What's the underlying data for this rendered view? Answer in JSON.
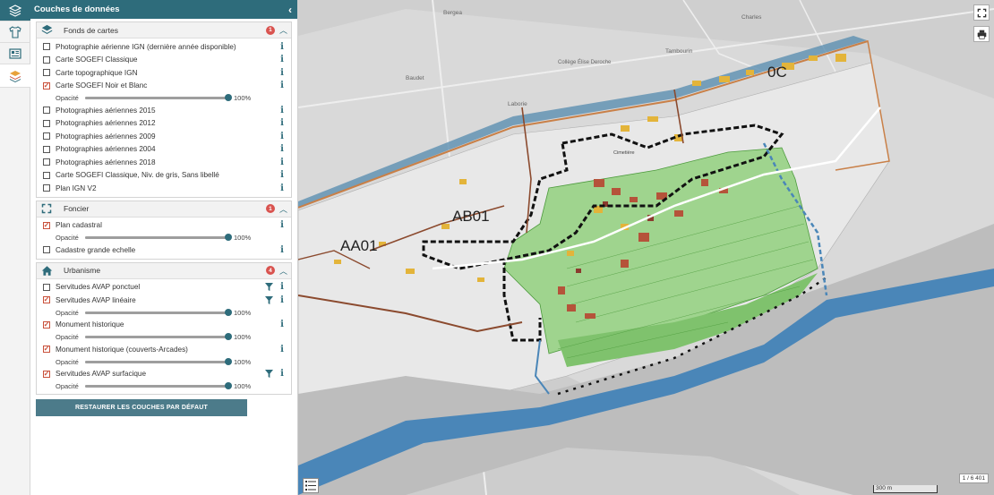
{
  "panel": {
    "title": "Couches de données"
  },
  "sections": {
    "fonds": {
      "title": "Fonds de cartes",
      "badge": "1",
      "layers": [
        {
          "label": "Photographie aérienne IGN (dernière année disponible)",
          "checked": false
        },
        {
          "label": "Carte SOGEFI Classique",
          "checked": false
        },
        {
          "label": "Carte topographique IGN",
          "checked": false
        },
        {
          "label": "Carte SOGEFI Noir et Blanc",
          "checked": true
        },
        {
          "label": "Photographies aériennes 2015",
          "checked": false
        },
        {
          "label": "Photographies aériennes 2012",
          "checked": false
        },
        {
          "label": "Photographies aériennes 2009",
          "checked": false
        },
        {
          "label": "Photographies aériennes 2004",
          "checked": false
        },
        {
          "label": "Photographies aériennes 2018",
          "checked": false
        },
        {
          "label": "Carte SOGEFI Classique, Niv. de gris, Sans libellé",
          "checked": false
        },
        {
          "label": "Plan IGN V2",
          "checked": false
        }
      ],
      "opacity": {
        "label": "Opacité",
        "value": "100%",
        "fraction": 1.0
      }
    },
    "foncier": {
      "title": "Foncier",
      "badge": "1",
      "layers": [
        {
          "label": "Plan cadastral",
          "checked": true
        },
        {
          "label": "Cadastre grande echelle",
          "checked": false
        }
      ],
      "opacity": {
        "label": "Opacité",
        "value": "100%",
        "fraction": 1.0
      }
    },
    "urbanisme": {
      "title": "Urbanisme",
      "badge": "4",
      "layers": [
        {
          "label": "Servitudes AVAP ponctuel",
          "checked": false
        },
        {
          "label": "Servitudes AVAP linéaire",
          "checked": true
        },
        {
          "label": "Monument historique",
          "checked": true
        },
        {
          "label": "Monument historique (couverts-Arcades)",
          "checked": true
        },
        {
          "label": "Servitudes AVAP surfacique",
          "checked": true
        }
      ],
      "opacity": {
        "label": "Opacité",
        "value": "100%",
        "fraction": 1.0
      }
    }
  },
  "restore_button": "RESTAURER LES COUCHES PAR DÉFAUT",
  "map": {
    "parcel_labels": [
      "0C",
      "AB01",
      "AA01"
    ],
    "place_labels": [
      "Bergea",
      "Charles",
      "Tambourin",
      "Baudet",
      "Laborie",
      "Collège Élise Deroche",
      "Cimetière"
    ],
    "scale_ratio": "1 / 6 401",
    "scale_bar": "300 m"
  },
  "colors": {
    "header": "#2e6c7b",
    "check": "#c9503a",
    "badge": "#d9534f",
    "river": "#4a86b8",
    "zone_green": "#8fcf7f",
    "building_orange": "#e3b43a"
  },
  "icons": {
    "rail": [
      "layers-icon",
      "shirt-icon",
      "newspaper-icon",
      "stack-icon"
    ],
    "map": [
      "fullscreen-icon",
      "print-icon",
      "legend-icon"
    ]
  }
}
